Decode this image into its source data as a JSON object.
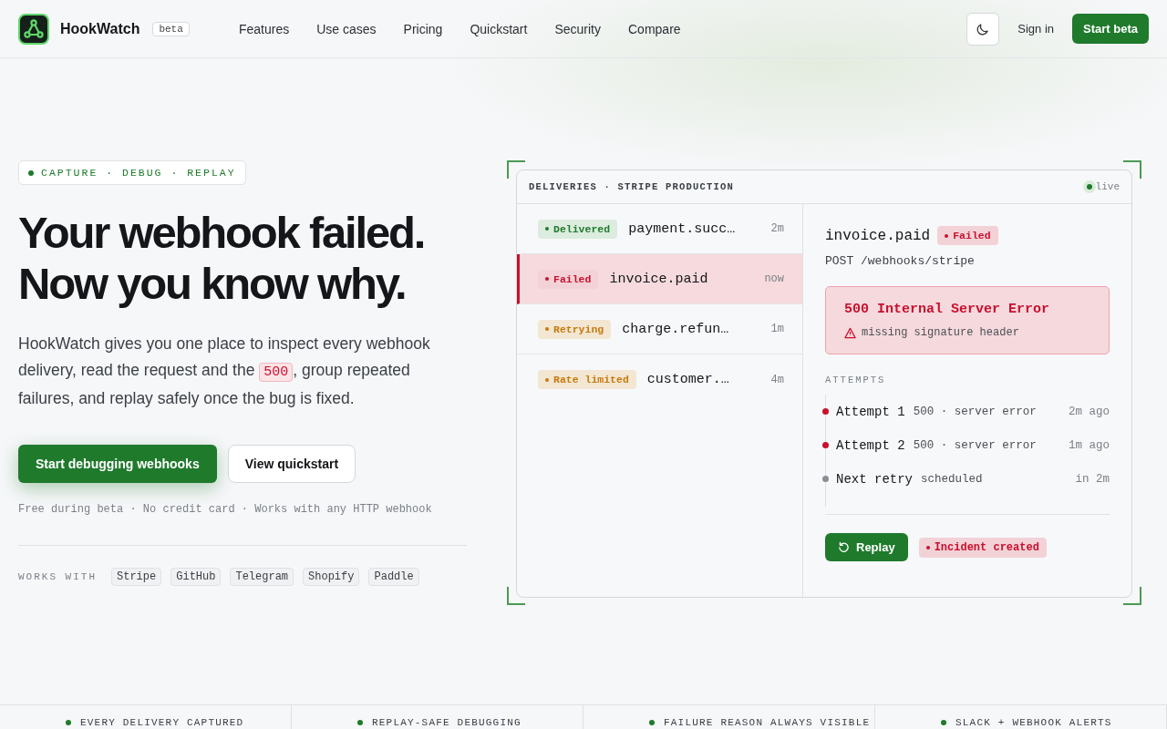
{
  "nav": {
    "brand": "HookWatch",
    "badge": "beta",
    "links": [
      "Features",
      "Use cases",
      "Pricing",
      "Quickstart",
      "Security",
      "Compare"
    ],
    "sign_in": "Sign in",
    "cta": "Start beta"
  },
  "hero": {
    "eyebrow": "CAPTURE · DEBUG · REPLAY",
    "title_lines": [
      "Your webhook failed.",
      "Now you know why."
    ],
    "lead_before": "HookWatch gives you one place to inspect every webhook delivery, read the request and the",
    "lead_code": "500",
    "lead_after": ", group repeated failures, and replay safely once the bug is fixed.",
    "primary": "Start debugging webhooks",
    "secondary": "View quickstart",
    "note": "Free during beta · No credit card · Works with any HTTP webhook",
    "works_label": "WORKS WITH",
    "integrations": [
      "Stripe",
      "GitHub",
      "Telegram",
      "Shopify",
      "Paddle"
    ]
  },
  "panel": {
    "title": "DELIVERIES · STRIPE PRODUCTION",
    "live": "live",
    "deliveries": [
      {
        "status": "Delivered",
        "kind": "delivered",
        "event": "payment.succ…",
        "time": "2m",
        "selected": false
      },
      {
        "status": "Failed",
        "kind": "failed",
        "event": "invoice.paid",
        "time": "now",
        "selected": true
      },
      {
        "status": "Retrying",
        "kind": "retrying",
        "event": "charge.refun…",
        "time": "1m",
        "selected": false
      },
      {
        "status": "Rate limited",
        "kind": "limited",
        "event": "customer.…",
        "time": "4m",
        "selected": false
      }
    ],
    "detail": {
      "event": "invoice.paid",
      "status": "Failed",
      "kind": "failed",
      "request": "POST /webhooks/stripe",
      "error_title": "500 Internal Server Error",
      "error_reason": "missing signature header",
      "attempts_label": "ATTEMPTS",
      "attempts": [
        {
          "name": "Attempt 1",
          "result": "500 · server error",
          "time": "2m ago",
          "kind": "failed"
        },
        {
          "name": "Attempt 2",
          "result": "500 · server error",
          "time": "1m ago",
          "kind": "failed"
        },
        {
          "name": "Next retry",
          "result": "scheduled",
          "time": "in 2m",
          "kind": "pending"
        }
      ],
      "replay": "Replay",
      "incident": "Incident created"
    }
  },
  "strip": [
    "EVERY DELIVERY CAPTURED",
    "REPLAY-SAFE DEBUGGING",
    "FAILURE REASON ALWAYS VISIBLE",
    "SLACK + WEBHOOK ALERTS"
  ]
}
